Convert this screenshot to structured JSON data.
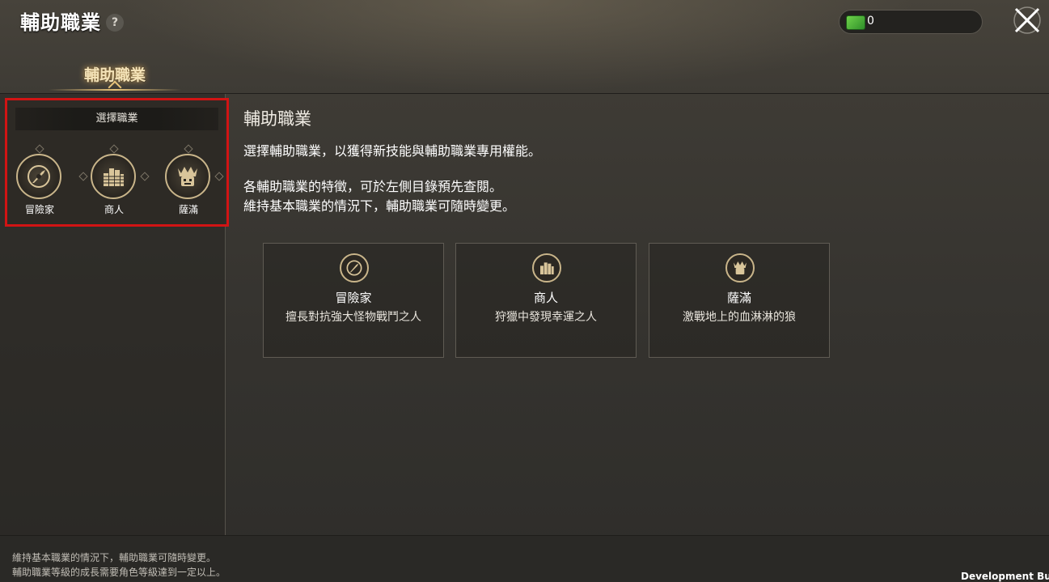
{
  "header": {
    "title": "輔助職業",
    "help_symbol": "?",
    "currency_value": "0",
    "currency_icon": "banknote-icon",
    "close_icon": "close-icon"
  },
  "tab": {
    "label": "輔助職業"
  },
  "sidebar": {
    "select_header": "選擇職業",
    "jobs": [
      {
        "label": "冒險家",
        "icon": "compass-icon"
      },
      {
        "label": "商人",
        "icon": "coins-icon"
      },
      {
        "label": "薩滿",
        "icon": "totem-mask-icon"
      }
    ]
  },
  "content": {
    "title": "輔助職業",
    "paragraph1": "選擇輔助職業，以獲得新技能與輔助職業專用權能。",
    "paragraph2_line1": "各輔助職業的特徵，可於左側目錄預先查閱。",
    "paragraph2_line2": "維持基本職業的情況下，輔助職業可隨時變更。",
    "cards": [
      {
        "name": "冒險家",
        "desc": "擅長對抗強大怪物戰鬥之人",
        "icon": "compass-icon"
      },
      {
        "name": "商人",
        "desc": "狩獵中發現幸運之人",
        "icon": "coins-icon"
      },
      {
        "name": "薩滿",
        "desc": "激戰地上的血淋淋的狼",
        "icon": "totem-mask-icon"
      }
    ]
  },
  "footer": {
    "line1": "維持基本職業的情況下，輔助職業可隨時變更。",
    "line2": "輔助職業等級的成長需要角色等級達到一定以上。"
  },
  "dev_build": "Development Build",
  "colors": {
    "gold_accent": "#c9b58a",
    "highlight_border": "#d11414",
    "currency_green": "#6fd34a"
  }
}
